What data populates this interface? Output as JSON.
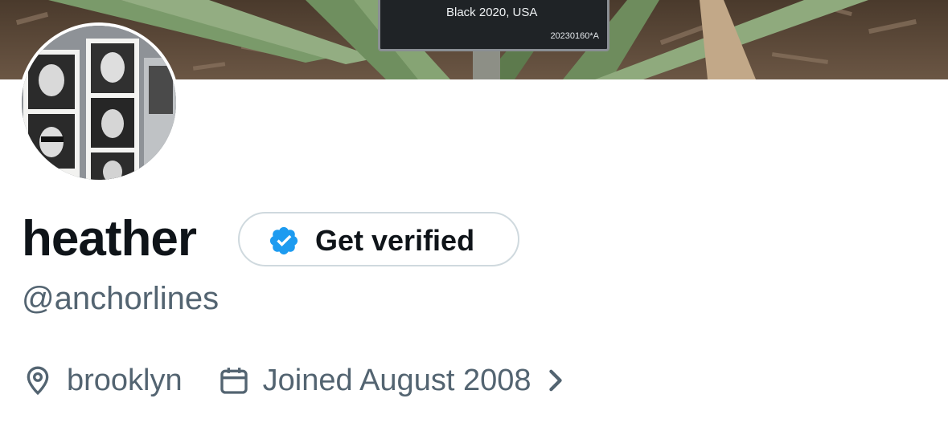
{
  "banner": {
    "plaque_text": "Black 2020, USA",
    "plaque_code": "20230160*A"
  },
  "profile": {
    "display_name": "heather",
    "handle": "@anchorlines",
    "verify_button_label": "Get verified",
    "location": "brooklyn",
    "joined": "Joined August 2008"
  },
  "colors": {
    "primary_text": "#0f1419",
    "secondary_text": "#536471",
    "verified_blue": "#1d9bf0",
    "border": "#cfd9de"
  },
  "icons": {
    "verify": "verified-badge-icon",
    "location": "location-pin-icon",
    "joined": "calendar-icon",
    "chevron": "chevron-right-icon"
  }
}
